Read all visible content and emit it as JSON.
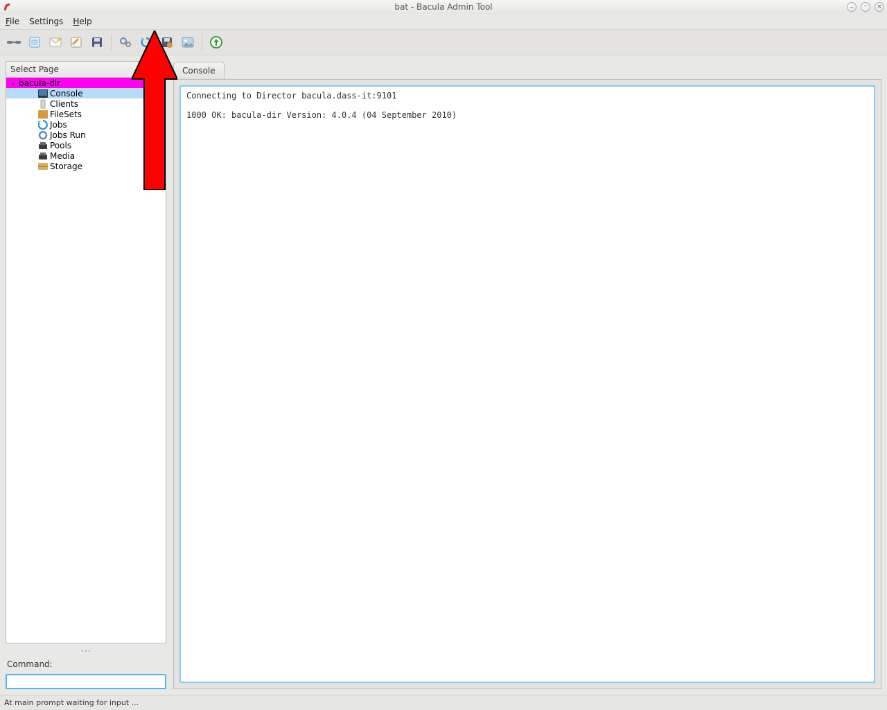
{
  "window": {
    "title": "bat - Bacula Admin Tool"
  },
  "menu": {
    "file": "File",
    "settings": "Settings",
    "help": "Help"
  },
  "toolbar": {
    "icons": [
      "connect",
      "page",
      "mail",
      "edit",
      "save",
      "gears",
      "refresh",
      "savejob",
      "image",
      "arrowup"
    ]
  },
  "sidebar": {
    "header": "Select Page",
    "root": "bacula-dir",
    "items": [
      {
        "label": "Console",
        "icon": "console",
        "selected": true
      },
      {
        "label": "Clients",
        "icon": "clients"
      },
      {
        "label": "FileSets",
        "icon": "filesets"
      },
      {
        "label": "Jobs",
        "icon": "jobs"
      },
      {
        "label": "Jobs Run",
        "icon": "jobsrun"
      },
      {
        "label": "Pools",
        "icon": "pools"
      },
      {
        "label": "Media",
        "icon": "media"
      },
      {
        "label": "Storage",
        "icon": "storage"
      }
    ]
  },
  "command": {
    "label": "Command:",
    "value": ""
  },
  "tab": {
    "label": "Console"
  },
  "console": {
    "text": "Connecting to Director bacula.dass-it:9101\n\n1000 OK: bacula-dir Version: 4.0.4 (04 September 2010)\n"
  },
  "status": {
    "text": "At main prompt waiting for input ..."
  }
}
